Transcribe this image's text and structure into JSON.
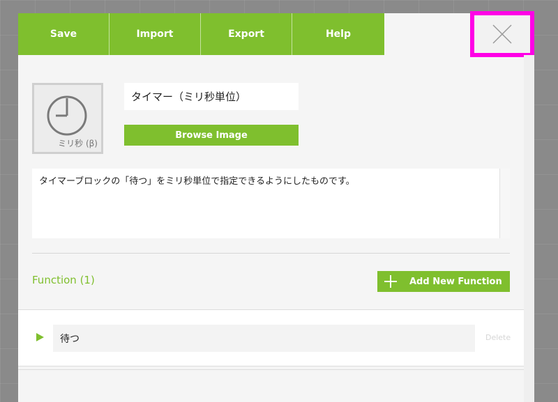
{
  "toolbar": {
    "save_label": "Save",
    "import_label": "Import",
    "export_label": "Export",
    "help_label": "Help",
    "close_icon": "close-icon"
  },
  "block": {
    "name": "タイマー（ミリ秒単位）",
    "thumbnail_label": "ミリ秒 (β)",
    "thumbnail_icon": "clock-icon",
    "browse_label": "Browse Image",
    "description": "タイマーブロックの「待つ」をミリ秒単位で指定できるようにしたものです。"
  },
  "functions": {
    "header": "Function (1)",
    "add_label": "Add New Function",
    "items": [
      {
        "name": "待つ",
        "delete_label": "Delete"
      }
    ]
  },
  "colors": {
    "accent": "#7fbf2e",
    "highlight": "#ff00e6"
  }
}
